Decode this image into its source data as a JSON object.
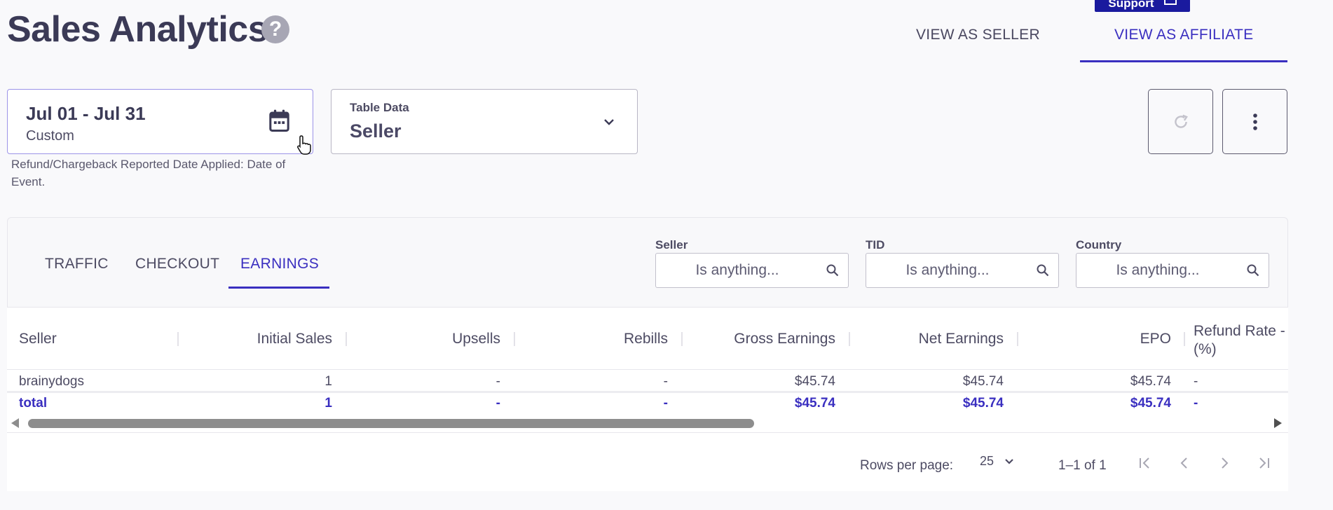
{
  "header": {
    "title": "Sales Analytics",
    "help_glyph": "?",
    "support_label": "Support",
    "view_tabs": [
      {
        "label": "VIEW AS SELLER",
        "active": false
      },
      {
        "label": "VIEW AS AFFILIATE",
        "active": true
      }
    ]
  },
  "date_picker": {
    "range": "Jul 01 - Jul 31",
    "mode": "Custom",
    "icon": "calendar-icon",
    "note": "Refund/Chargeback Reported Date Applied: Date of Event."
  },
  "table_data": {
    "label": "Table Data",
    "value": "Seller"
  },
  "report_tabs": [
    {
      "label": "TRAFFIC",
      "active": false
    },
    {
      "label": "CHECKOUT",
      "active": false
    },
    {
      "label": "EARNINGS",
      "active": true
    }
  ],
  "filters": [
    {
      "label": "Seller",
      "placeholder": "Is anything..."
    },
    {
      "label": "TID",
      "placeholder": "Is anything..."
    },
    {
      "label": "Country",
      "placeholder": "Is anything..."
    }
  ],
  "table": {
    "columns": [
      "Seller",
      "Initial Sales",
      "Upsells",
      "Rebills",
      "Gross Earnings",
      "Net Earnings",
      "EPO",
      "Refund Rate -",
      "(%)"
    ],
    "rows": [
      {
        "seller": "brainydogs",
        "initial_sales": "1",
        "upsells": "-",
        "rebills": "-",
        "gross": "$45.74",
        "net": "$45.74",
        "epo": "$45.74",
        "refund_rate": "-"
      }
    ],
    "total": {
      "seller": "total",
      "initial_sales": "1",
      "upsells": "-",
      "rebills": "-",
      "gross": "$45.74",
      "net": "$45.74",
      "epo": "$45.74",
      "refund_rate": "-"
    }
  },
  "pagination": {
    "rows_label": "Rows per page:",
    "rows_value": "25",
    "range": "1–1 of 1"
  },
  "colors": {
    "accent": "#3a2fc0",
    "support_bg": "#1a1a9e",
    "title": "#3b3a56"
  }
}
